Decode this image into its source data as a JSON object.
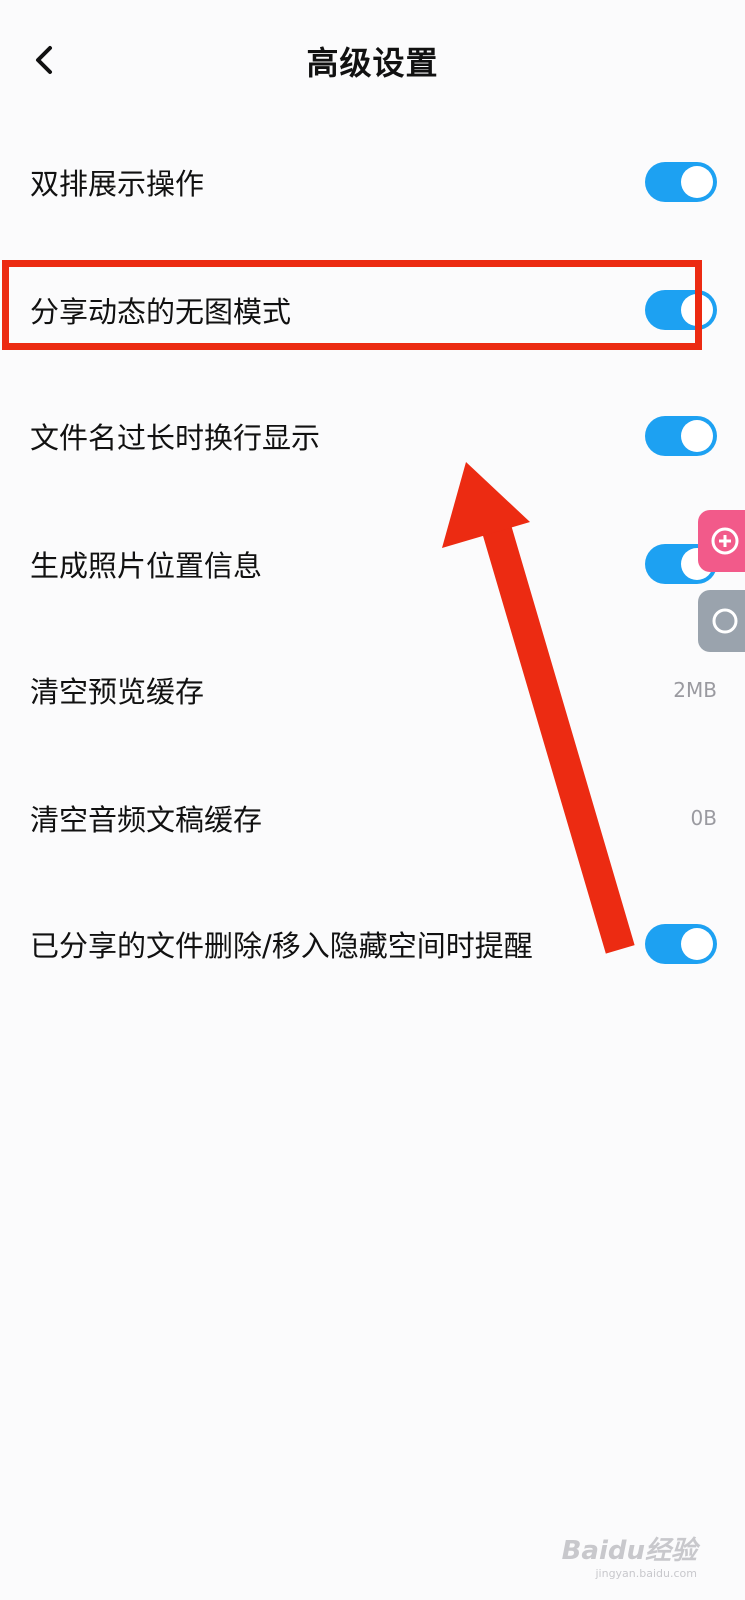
{
  "header": {
    "title": "高级设置"
  },
  "settings": [
    {
      "label": "双排展示操作",
      "type": "toggle",
      "on": true
    },
    {
      "label": "分享动态的无图模式",
      "type": "toggle",
      "on": true,
      "highlighted": true
    },
    {
      "label": "文件名过长时换行显示",
      "type": "toggle",
      "on": true
    },
    {
      "label": "生成照片位置信息",
      "type": "toggle",
      "on": true
    },
    {
      "label": "清空预览缓存",
      "type": "value",
      "value": "2MB"
    },
    {
      "label": "清空音频文稿缓存",
      "type": "value",
      "value": "0B"
    },
    {
      "label": "已分享的文件删除/移入隐藏空间时提醒",
      "type": "toggle",
      "on": true
    }
  ],
  "colors": {
    "toggle_on": "#1da1f2",
    "highlight": "#ec2b12",
    "background": "#fbfbfc"
  },
  "watermark": {
    "logo": "Baidu经验",
    "url": "jingyan.baidu.com"
  }
}
